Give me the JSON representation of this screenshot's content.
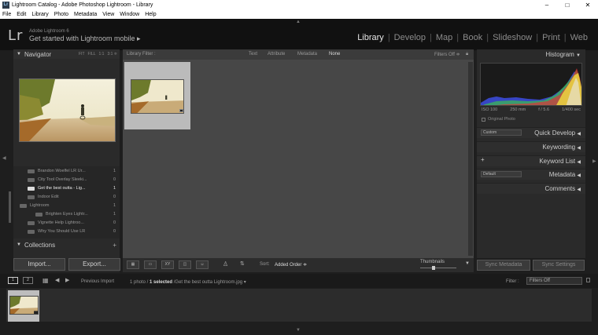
{
  "window": {
    "title": "Lightroom Catalog - Adobe Photoshop Lightroom - Library",
    "app_icon": "Lr",
    "controls": [
      "–",
      "□",
      "✕"
    ]
  },
  "menubar": [
    "File",
    "Edit",
    "Library",
    "Photo",
    "Metadata",
    "View",
    "Window",
    "Help"
  ],
  "identity": {
    "logo": "Lr",
    "version": "Adobe Lightroom 6",
    "mobile_link": "Get started with Lightroom mobile ▸"
  },
  "modules": {
    "items": [
      "Library",
      "Develop",
      "Map",
      "Book",
      "Slideshow",
      "Print",
      "Web"
    ],
    "active": "Library"
  },
  "navigator": {
    "title": "Navigator",
    "zoom_options": [
      "FIT",
      "FILL",
      "1:1",
      "3:1 ≑"
    ]
  },
  "folders": [
    {
      "name": "Brandon Woelfel LR Ur...",
      "count": "1"
    },
    {
      "name": "City Tool Overlay Sleeki...",
      "count": "0"
    },
    {
      "name": "Get the best outta - Lig...",
      "count": "1",
      "selected": true
    },
    {
      "name": "Indoor Edit",
      "count": "0"
    },
    {
      "name": "Lightroom",
      "count": "1"
    },
    {
      "name": "Brighten Eyes Lightr...",
      "count": "1"
    },
    {
      "name": "Vignette Help Lightroo...",
      "count": "0"
    },
    {
      "name": "Why You Should Use LR",
      "count": "0"
    }
  ],
  "collections": {
    "title": "Collections",
    "add": "+"
  },
  "buttons": {
    "import": "Import...",
    "export": "Export..."
  },
  "filter_bar": {
    "label": "Library Filter :",
    "options": [
      "Text",
      "Attribute",
      "Metadata",
      "None"
    ],
    "active": "None",
    "filters_off": "Filters Off ≑"
  },
  "toolbar": {
    "view_modes": [
      "▦",
      "▭",
      "XY",
      "◫",
      "☺"
    ],
    "sort_label": "Sort:",
    "sort_value": "Added Order ≑",
    "thumbnails_label": "Thumbnails",
    "thumbnail_size": 0.35
  },
  "histogram": {
    "title": "Histogram",
    "iso": "ISO 100",
    "focal": "250 mm",
    "aperture": "f / 5.6",
    "shutter": "1/400 sec",
    "original_photo": "Original Photo"
  },
  "right_sections": {
    "quick_develop": "Quick Develop",
    "quick_develop_preset": "Custom",
    "keywording": "Keywording",
    "keyword_list": "Keyword List",
    "keyword_add": "+",
    "metadata": "Metadata",
    "metadata_preset": "Default",
    "comments": "Comments"
  },
  "sync": {
    "metadata": "Sync Metadata",
    "settings": "Sync Settings"
  },
  "filmstrip_bar": {
    "screen1": "1",
    "screen2": "2",
    "source": "Previous Import",
    "status_prefix": "1 photo / ",
    "status_selected": "1 selected",
    "status_suffix": " /Get the best outta Lightroom.jpg ▾",
    "filter_label": "Filter :",
    "filter_value": "Filters Off"
  },
  "arrows": {
    "top": "▲",
    "bottom": "▼",
    "left": "◀",
    "right": "▶"
  }
}
